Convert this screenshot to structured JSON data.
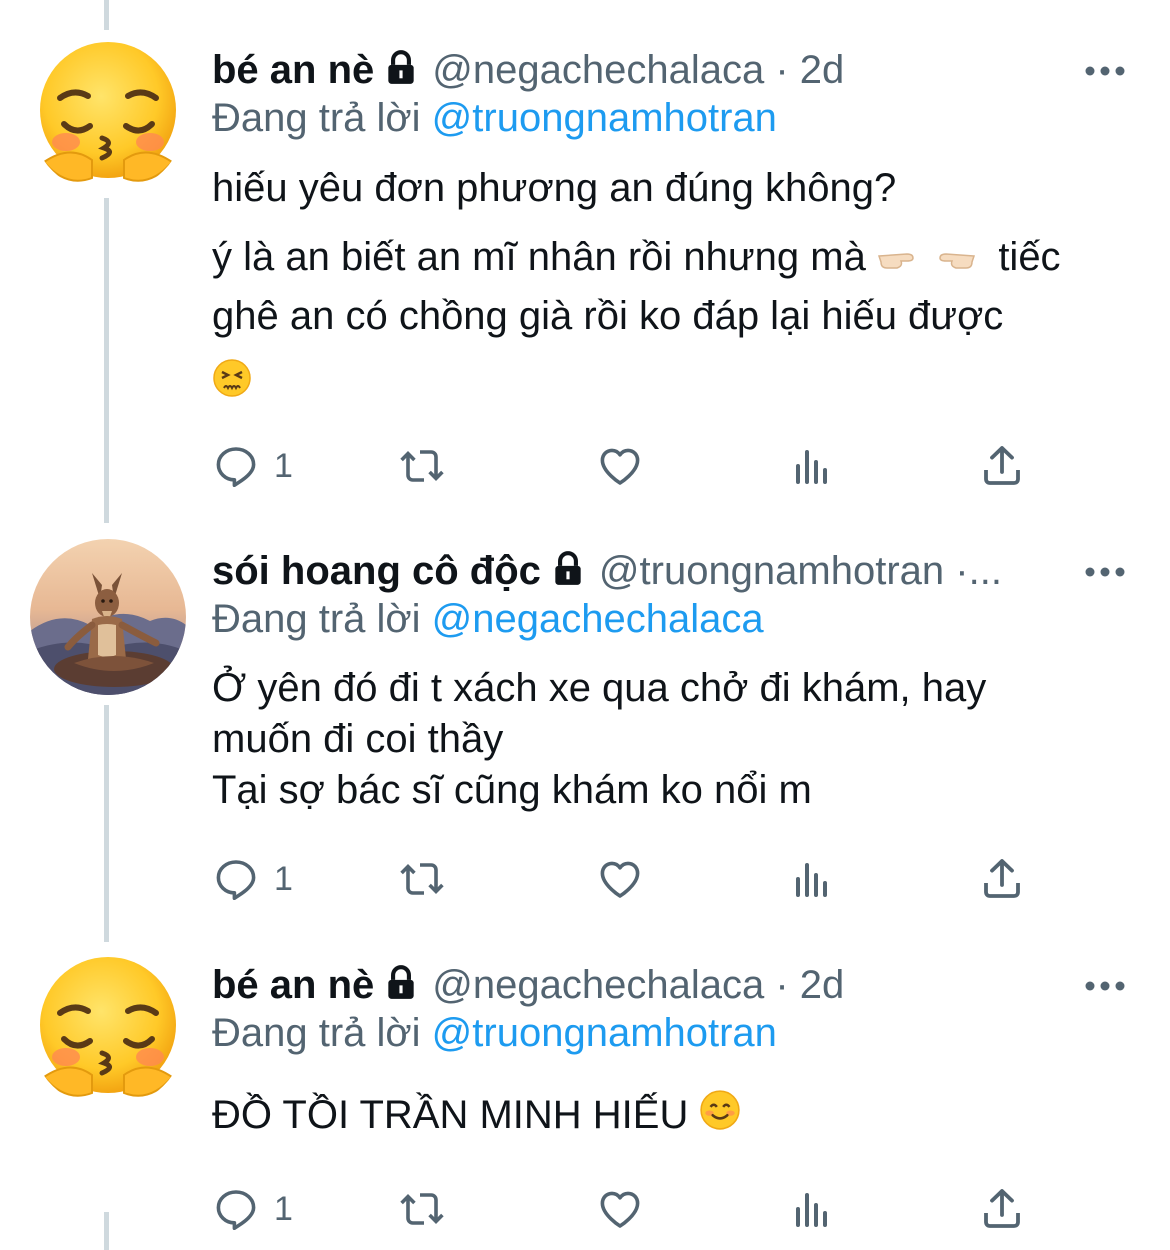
{
  "tweets": [
    {
      "author_name": "bé an nè",
      "handle_meta": "@negachechalaca · 2d",
      "avatar_icon": "pensive-face-emoji-icon",
      "replying_prefix": "Đang trả lời",
      "replying_to": "@truongnamhotran",
      "line1": "hiếu yêu đơn phương an đúng không?",
      "line2a": "ý là an biết an mĩ nhân rồi nhưng mà",
      "line2b": "tiếc",
      "line3": "ghê an có chồng già rồi ko đáp lại hiếu được",
      "reply_count": "1"
    },
    {
      "author_name": "sói hoang cô độc",
      "handle_meta": "@truongnamhotran ·...",
      "avatar_icon": "wolf-meditating-avatar",
      "replying_prefix": "Đang trả lời",
      "replying_to": "@negachechalaca",
      "line1": "Ở yên đó đi t xách xe qua chở đi khám, hay",
      "line2": "muốn đi coi thầy",
      "line3": "Tại sợ bác sĩ cũng khám ko nổi m",
      "reply_count": "1"
    },
    {
      "author_name": "bé an nè",
      "handle_meta": "@negachechalaca · 2d",
      "avatar_icon": "pensive-face-emoji-icon",
      "replying_prefix": "Đang trả lời",
      "replying_to": "@truongnamhotran",
      "line1": "ĐỒ TỒI TRẦN MINH HIẾU",
      "reply_count": "1"
    }
  ],
  "colors": {
    "text": "#0f1419",
    "secondary": "#536471",
    "accent": "#1d9bf0",
    "thread_line": "#cfd9de"
  }
}
